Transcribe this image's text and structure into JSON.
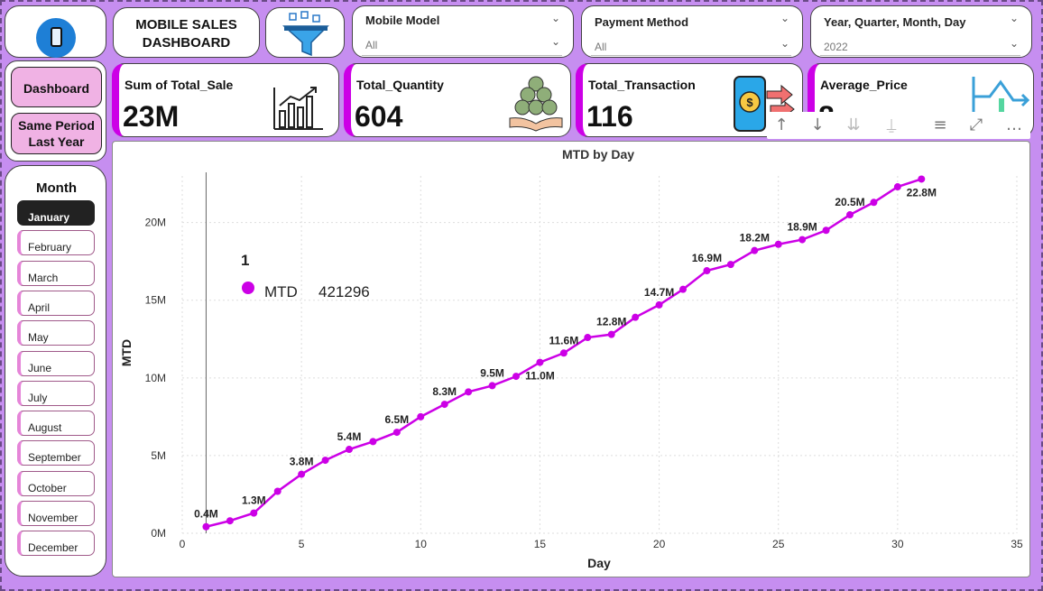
{
  "header": {
    "title_line1": "MOBILE SALES",
    "title_line2": "DASHBOARD"
  },
  "icons": {
    "logo": "mobile-phone-icon",
    "filter": "funnel-filter-icon"
  },
  "slicers": [
    {
      "title": "Mobile Model",
      "value": "All"
    },
    {
      "title": "Payment Method",
      "value": "All"
    },
    {
      "title": "Year, Quarter, Month, Day",
      "value": "2022"
    }
  ],
  "nav": {
    "dashboard": "Dashboard",
    "same_period_line1": "Same Period",
    "same_period_line2": "Last Year"
  },
  "kpis": [
    {
      "label": "Sum of Total_Sale",
      "value": "23M",
      "icon": "bar-growth-chart-icon"
    },
    {
      "label": "Total_Quantity",
      "value": "604",
      "icon": "money-bags-hands-icon"
    },
    {
      "label": "Total_Transaction",
      "value": "116",
      "icon": "mobile-payment-icon"
    },
    {
      "label": "Average_Price",
      "value": "8",
      "icon": "trend-line-icon"
    }
  ],
  "month_slicer": {
    "title": "Month",
    "selected": "January",
    "items": [
      "January",
      "February",
      "March",
      "April",
      "May",
      "June",
      "July",
      "August",
      "September",
      "October",
      "November",
      "December"
    ]
  },
  "toolbar_icons": [
    "drill-up-icon",
    "drill-down-icon",
    "expand-all-icon",
    "drill-through-icon",
    "filter-icon",
    "focus-mode-icon",
    "more-options-icon"
  ],
  "colors": {
    "background": "#c68ef0",
    "accent": "#cc00e6",
    "nav_button": "#f0b2e4",
    "active_month": "#222222"
  },
  "chart_data": {
    "type": "line",
    "title": "MTD by Day",
    "xlabel": "Day",
    "ylabel": "MTD",
    "xlim": [
      0,
      35
    ],
    "ylim": [
      0,
      23000000
    ],
    "x_ticks": [
      0,
      5,
      10,
      15,
      20,
      25,
      30,
      35
    ],
    "y_ticks": [
      0,
      5000000,
      10000000,
      15000000,
      20000000
    ],
    "y_tick_labels": [
      "0M",
      "5M",
      "10M",
      "15M",
      "20M"
    ],
    "grid": true,
    "series": [
      {
        "name": "MTD",
        "color": "#cc00e6",
        "x": [
          1,
          2,
          3,
          4,
          5,
          6,
          7,
          8,
          9,
          10,
          11,
          12,
          13,
          14,
          15,
          16,
          17,
          18,
          19,
          20,
          21,
          22,
          23,
          24,
          25,
          26,
          27,
          28,
          29,
          30,
          31
        ],
        "y": [
          421296,
          800000,
          1300000,
          2700000,
          3800000,
          4700000,
          5400000,
          5900000,
          6500000,
          7500000,
          8300000,
          9100000,
          9500000,
          10100000,
          11000000,
          11600000,
          12600000,
          12800000,
          13900000,
          14700000,
          15700000,
          16900000,
          17300000,
          18200000,
          18600000,
          18900000,
          19500000,
          20500000,
          21300000,
          22300000,
          22800000
        ]
      }
    ],
    "data_labels": [
      {
        "x": 1,
        "text": "0.4M",
        "pos": "above"
      },
      {
        "x": 3,
        "text": "1.3M",
        "pos": "above"
      },
      {
        "x": 5,
        "text": "3.8M",
        "pos": "above"
      },
      {
        "x": 7,
        "text": "5.4M",
        "pos": "above"
      },
      {
        "x": 9,
        "text": "6.5M",
        "pos": "above"
      },
      {
        "x": 11,
        "text": "8.3M",
        "pos": "above"
      },
      {
        "x": 13,
        "text": "9.5M",
        "pos": "above"
      },
      {
        "x": 15,
        "text": "11.0M",
        "pos": "below"
      },
      {
        "x": 16,
        "text": "11.6M",
        "pos": "above"
      },
      {
        "x": 18,
        "text": "12.8M",
        "pos": "above"
      },
      {
        "x": 20,
        "text": "14.7M",
        "pos": "above"
      },
      {
        "x": 22,
        "text": "16.9M",
        "pos": "above"
      },
      {
        "x": 24,
        "text": "18.2M",
        "pos": "above"
      },
      {
        "x": 26,
        "text": "18.9M",
        "pos": "above"
      },
      {
        "x": 28,
        "text": "20.5M",
        "pos": "above"
      },
      {
        "x": 31,
        "text": "22.8M",
        "pos": "below"
      }
    ],
    "tooltip": {
      "title": "1",
      "series": "MTD",
      "value": "421296",
      "x": 1
    }
  }
}
